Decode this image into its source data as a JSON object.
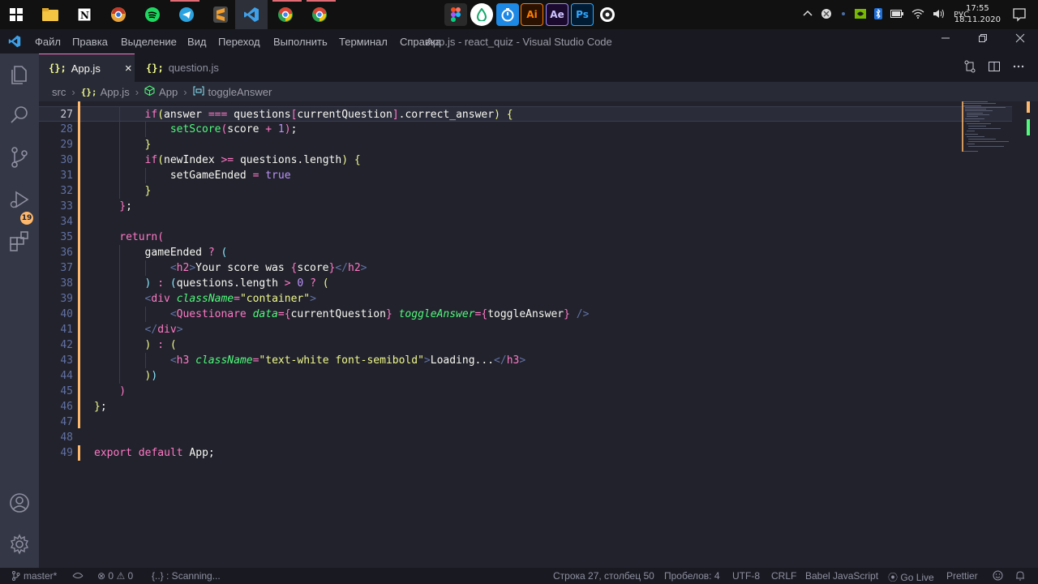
{
  "taskbar": {
    "apps": [
      {
        "name": "windows-start",
        "color": "#ffffff"
      },
      {
        "name": "file-explorer",
        "color": "#f4c542"
      },
      {
        "name": "notion",
        "color": "#ffffff"
      },
      {
        "name": "chrome-canary",
        "color": "#e8a33c"
      },
      {
        "name": "spotify",
        "color": "#1ed760"
      },
      {
        "name": "telegram",
        "color": "#2aa3e0"
      },
      {
        "name": "sublime-text",
        "color": "#f49e2c"
      },
      {
        "name": "vscode",
        "color": "#3ea0e8"
      },
      {
        "name": "chrome-1",
        "color": "#4b9ee8"
      },
      {
        "name": "chrome-2",
        "color": "#4b9ee8"
      }
    ],
    "pinned": [
      {
        "name": "figma",
        "label": ""
      },
      {
        "name": "app-green",
        "label": ""
      },
      {
        "name": "timer",
        "label": ""
      },
      {
        "name": "illustrator",
        "label": "Ai"
      },
      {
        "name": "after-effects",
        "label": "Ae"
      },
      {
        "name": "photoshop",
        "label": "Ps"
      },
      {
        "name": "obs",
        "label": ""
      }
    ],
    "language": "РУС",
    "time": "17:55",
    "date": "18.11.2020"
  },
  "titlebar": {
    "menu": [
      "Файл",
      "Правка",
      "Выделение",
      "Вид",
      "Переход",
      "Выполнить",
      "Терминал",
      "Справка"
    ],
    "title": "App.js - react_quiz - Visual Studio Code"
  },
  "activitybar": {
    "scm_badge": "19"
  },
  "tabs": [
    {
      "icon": "{};",
      "label": "App.js",
      "active": true,
      "close": "×"
    },
    {
      "icon": "{};",
      "label": "question.js",
      "active": false
    }
  ],
  "breadcrumb": {
    "folder": "src",
    "file_icon": "{};",
    "file": "App.js",
    "component": "App",
    "symbol": "toggleAnswer"
  },
  "code": {
    "current_line": 27,
    "lines": [
      {
        "n": 27,
        "indent": 8
      },
      {
        "n": 28,
        "indent": 12
      },
      {
        "n": 29,
        "indent": 8
      },
      {
        "n": 30,
        "indent": 8
      },
      {
        "n": 31,
        "indent": 12
      },
      {
        "n": 32,
        "indent": 8
      },
      {
        "n": 33,
        "indent": 4
      },
      {
        "n": 34,
        "indent": 0
      },
      {
        "n": 35,
        "indent": 4
      },
      {
        "n": 36,
        "indent": 8
      },
      {
        "n": 37,
        "indent": 12
      },
      {
        "n": 38,
        "indent": 8
      },
      {
        "n": 39,
        "indent": 8
      },
      {
        "n": 40,
        "indent": 12
      },
      {
        "n": 41,
        "indent": 8
      },
      {
        "n": 42,
        "indent": 8
      },
      {
        "n": 43,
        "indent": 12
      },
      {
        "n": 44,
        "indent": 8
      },
      {
        "n": 45,
        "indent": 4
      },
      {
        "n": 46,
        "indent": 0
      },
      {
        "n": 47,
        "indent": 0
      },
      {
        "n": 48,
        "indent": 0
      },
      {
        "n": 49,
        "indent": 0
      }
    ],
    "tokens": {
      "27": [
        [
          "kw",
          "if"
        ],
        [
          "br1",
          "("
        ],
        [
          "",
          "answer "
        ],
        [
          "kw",
          "==="
        ],
        [
          "",
          " questions"
        ],
        [
          "br2",
          "["
        ],
        [
          "",
          "currentQuestion"
        ],
        [
          "br2",
          "]"
        ],
        [
          "",
          ".correct_answer"
        ],
        [
          "br1",
          ")"
        ],
        [
          "",
          " "
        ],
        [
          "br1",
          "{"
        ]
      ],
      "28": [
        [
          "fn",
          "setScore"
        ],
        [
          "br2",
          "("
        ],
        [
          "",
          "score "
        ],
        [
          "kw",
          "+"
        ],
        [
          "",
          " "
        ],
        [
          "num",
          "1"
        ],
        [
          "br2",
          ")"
        ],
        [
          "",
          ";"
        ]
      ],
      "29": [
        [
          "br1",
          "}"
        ]
      ],
      "30": [
        [
          "kw",
          "if"
        ],
        [
          "br1",
          "("
        ],
        [
          "",
          "newIndex "
        ],
        [
          "kw",
          ">="
        ],
        [
          "",
          " questions.length"
        ],
        [
          "br1",
          ")"
        ],
        [
          "",
          " "
        ],
        [
          "br1",
          "{"
        ]
      ],
      "31": [
        [
          "",
          "setGameEnded "
        ],
        [
          "kw",
          "="
        ],
        [
          "",
          " "
        ],
        [
          "num",
          "true"
        ]
      ],
      "32": [
        [
          "br1",
          "}"
        ]
      ],
      "33": [
        [
          "br2",
          "}"
        ],
        [
          "",
          ";"
        ]
      ],
      "34": [],
      "35": [
        [
          "kw",
          "return"
        ],
        [
          "br2",
          "("
        ]
      ],
      "36": [
        [
          "",
          "gameEnded "
        ],
        [
          "kw",
          "?"
        ],
        [
          "",
          " "
        ],
        [
          "br3",
          "("
        ]
      ],
      "37": [
        [
          "punc",
          "<"
        ],
        [
          "tag",
          "h2"
        ],
        [
          "punc",
          ">"
        ],
        [
          "",
          "Your score was "
        ],
        [
          "kw",
          "{"
        ],
        [
          "",
          "score"
        ],
        [
          "kw",
          "}"
        ],
        [
          "punc",
          "</"
        ],
        [
          "tag",
          "h2"
        ],
        [
          "punc",
          ">"
        ]
      ],
      "38": [
        [
          "br3",
          ")"
        ],
        [
          "",
          " "
        ],
        [
          "kw",
          ":"
        ],
        [
          "",
          " "
        ],
        [
          "br3",
          "("
        ],
        [
          "",
          "questions.length "
        ],
        [
          "kw",
          ">"
        ],
        [
          "",
          " "
        ],
        [
          "num",
          "0"
        ],
        [
          "",
          " "
        ],
        [
          "kw",
          "?"
        ],
        [
          "",
          " "
        ],
        [
          "br1",
          "("
        ]
      ],
      "39": [
        [
          "punc",
          "<"
        ],
        [
          "tag",
          "div"
        ],
        [
          "",
          " "
        ],
        [
          "attr",
          "className"
        ],
        [
          "kw",
          "="
        ],
        [
          "str",
          "\"container\""
        ],
        [
          "punc",
          ">"
        ]
      ],
      "40": [
        [
          "punc",
          "<"
        ],
        [
          "tag",
          "Questionare"
        ],
        [
          "",
          " "
        ],
        [
          "attr",
          "data"
        ],
        [
          "kw",
          "={"
        ],
        [
          "",
          "currentQuestion"
        ],
        [
          "kw",
          "}"
        ],
        [
          "",
          " "
        ],
        [
          "attr",
          "toggleAnswer"
        ],
        [
          "kw",
          "={"
        ],
        [
          "",
          "toggleAnswer"
        ],
        [
          "kw",
          "}"
        ],
        [
          "",
          " "
        ],
        [
          "punc",
          "/>"
        ]
      ],
      "41": [
        [
          "punc",
          "</"
        ],
        [
          "tag",
          "div"
        ],
        [
          "punc",
          ">"
        ]
      ],
      "42": [
        [
          "br1",
          ")"
        ],
        [
          "",
          " "
        ],
        [
          "kw",
          ":"
        ],
        [
          "",
          " "
        ],
        [
          "br1",
          "("
        ]
      ],
      "43": [
        [
          "punc",
          "<"
        ],
        [
          "tag",
          "h3"
        ],
        [
          "",
          " "
        ],
        [
          "attr",
          "className"
        ],
        [
          "kw",
          "="
        ],
        [
          "str",
          "\"text-white font-semibold\""
        ],
        [
          "punc",
          ">"
        ],
        [
          "",
          "Loading..."
        ],
        [
          "punc",
          "</"
        ],
        [
          "tag",
          "h3"
        ],
        [
          "punc",
          ">"
        ]
      ],
      "44": [
        [
          "br1",
          ")"
        ],
        [
          "br3",
          ")"
        ]
      ],
      "45": [
        [
          "br2",
          ")"
        ]
      ],
      "46": [
        [
          "br1",
          "}"
        ],
        [
          "",
          ";"
        ]
      ],
      "47": [],
      "48": [],
      "49": [
        [
          "kw",
          "export"
        ],
        [
          "",
          " "
        ],
        [
          "kw",
          "default"
        ],
        [
          "",
          " App;"
        ]
      ]
    }
  },
  "statusbar": {
    "branch": "master*",
    "errors": "0",
    "warnings": "0",
    "scanning": "{..} : Scanning...",
    "position": "Строка 27, столбец 50",
    "spaces": "Пробелов: 4",
    "encoding": "UTF-8",
    "eol": "CRLF",
    "language": "Babel JavaScript",
    "golive": "Go Live",
    "prettier": "Prettier"
  }
}
